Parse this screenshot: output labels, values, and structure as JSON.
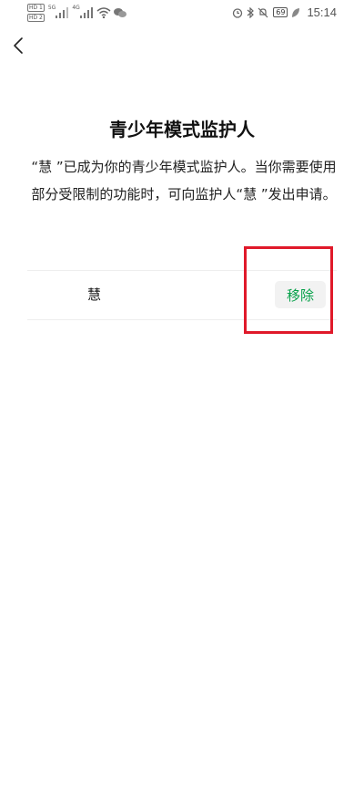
{
  "status_bar": {
    "hd1": "HD 1",
    "hd2": "HD 2",
    "net1": "5G",
    "net2": "4G",
    "battery": "69",
    "time": "15:14"
  },
  "page": {
    "title": "青少年模式监护人",
    "description": "“慧 ”已成为你的青少年模式监护人。当你需要使用部分受限制的功能时，可向监护人“慧 ”发出申请。"
  },
  "guardian": {
    "name": "慧",
    "remove_label": "移除"
  },
  "colors": {
    "accent_green": "#07a14a",
    "highlight_red": "#e0192a"
  },
  "icons": {
    "back": "chevron-left-icon",
    "wifi": "wifi-icon",
    "wechat": "wechat-icon",
    "alarm": "alarm-icon",
    "bluetooth": "bluetooth-icon",
    "mute": "bell-off-icon",
    "leaf": "leaf-icon"
  }
}
